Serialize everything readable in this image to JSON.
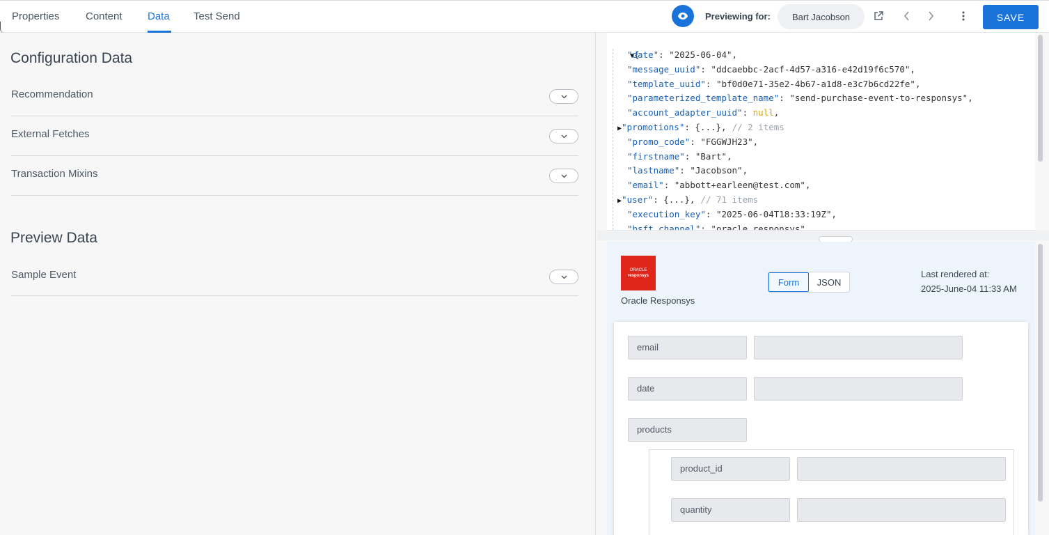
{
  "tabs": [
    {
      "label": "Properties",
      "active": false
    },
    {
      "label": "Content",
      "active": false
    },
    {
      "label": "Data",
      "active": true
    },
    {
      "label": "Test Send",
      "active": false
    }
  ],
  "header": {
    "previewing_label": "Previewing for:",
    "previewing_user": "Bart Jacobson",
    "save_label": "SAVE",
    "accent_color": "#1a73d9"
  },
  "config": {
    "title": "Configuration Data",
    "items": [
      "Recommendation",
      "External Fetches",
      "Transaction Mixins"
    ]
  },
  "preview_data": {
    "title": "Preview Data",
    "items": [
      "Sample Event"
    ]
  },
  "json_viewer": {
    "open_brace": "{",
    "lines": [
      {
        "key": "\"date\"",
        "value": "\"2025-06-04\"",
        "type": "string"
      },
      {
        "key": "\"message_uuid\"",
        "value": "\"ddcaebbc-2acf-4d57-a316-e42d19f6c570\"",
        "type": "string"
      },
      {
        "key": "\"template_uuid\"",
        "value": "\"bf0d0e71-35e2-4b67-a1d8-e3c7b6cd22fe\"",
        "type": "string"
      },
      {
        "key": "\"parameterized_template_name\"",
        "value": "\"send-purchase-event-to-responsys\"",
        "type": "string"
      },
      {
        "key": "\"account_adapter_uuid\"",
        "value": "null",
        "type": "null"
      },
      {
        "key": "\"promotions\"",
        "value": "{...}",
        "type": "collapsed",
        "comment": "// 2 items"
      },
      {
        "key": "\"promo_code\"",
        "value": "\"FGGWJH23\"",
        "type": "string"
      },
      {
        "key": "\"firstname\"",
        "value": "\"Bart\"",
        "type": "string"
      },
      {
        "key": "\"lastname\"",
        "value": "\"Jacobson\"",
        "type": "string"
      },
      {
        "key": "\"email\"",
        "value": "\"abbott+earleen@test.com\"",
        "type": "string"
      },
      {
        "key": "\"user\"",
        "value": "{...}",
        "type": "collapsed",
        "comment": "// 71 items"
      },
      {
        "key": "\"execution_key\"",
        "value": "\"2025-06-04T18:33:19Z\"",
        "type": "string"
      },
      {
        "key": "\"bsft_channel\"",
        "value": "\"oracle_responsys\"",
        "type": "string"
      }
    ]
  },
  "renderer": {
    "logo_line1": "ORACLE",
    "logo_line2": "responsys",
    "name": "Oracle Responsys",
    "toggle": [
      "Form",
      "JSON"
    ],
    "active_toggle": "Form",
    "last_rendered_label": "Last rendered at:",
    "last_rendered_value": "2025-June-04 11:33 AM",
    "brand_color": "#e0261a"
  },
  "form": {
    "fields": [
      {
        "label": "email",
        "value": ""
      },
      {
        "label": "date",
        "value": ""
      },
      {
        "label": "products"
      }
    ],
    "nested_fields": [
      {
        "label": "product_id",
        "value": ""
      },
      {
        "label": "quantity",
        "value": ""
      }
    ]
  }
}
